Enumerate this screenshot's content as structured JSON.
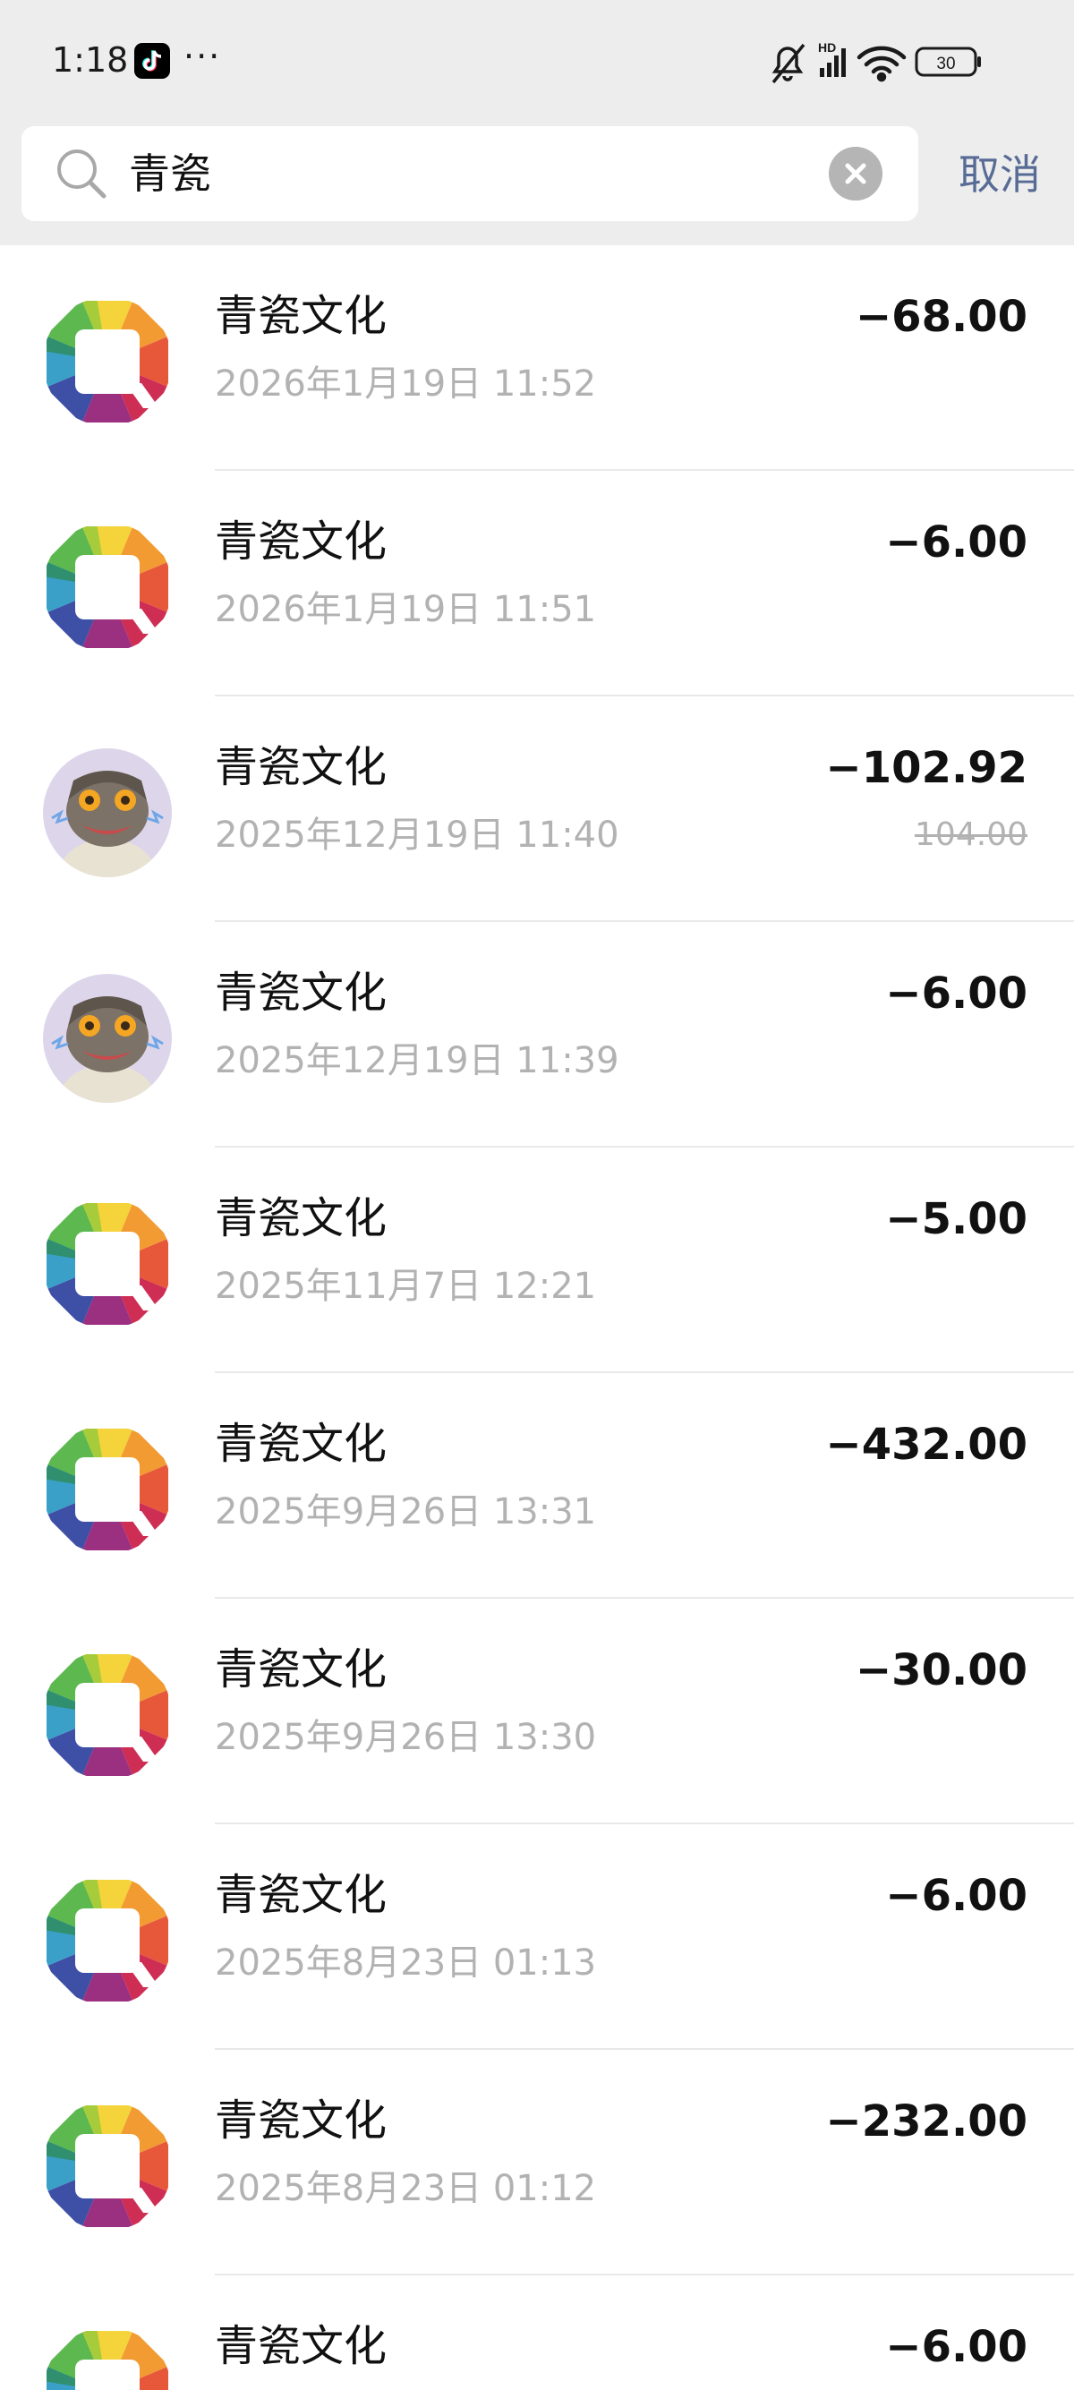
{
  "status_bar": {
    "time": "1:18",
    "overflow": "···",
    "icons": [
      "tiktok-icon",
      "mute-icon",
      "signal-icon",
      "wifi-icon",
      "battery-icon"
    ],
    "battery_level": "30"
  },
  "search": {
    "query": "青瓷",
    "cancel_label": "取消"
  },
  "colors": {
    "header_bg": "#ededed",
    "cancel": "#576b95",
    "secondary_text": "#b2b2b2"
  },
  "transactions": [
    {
      "merchant": "青瓷文化",
      "date": "2026年1月19日 11:52",
      "amount": "−68.00",
      "avatar": "logo-q"
    },
    {
      "merchant": "青瓷文化",
      "date": "2026年1月19日 11:51",
      "amount": "−6.00",
      "avatar": "logo-q"
    },
    {
      "merchant": "青瓷文化",
      "date": "2025年12月19日 11:40",
      "amount": "−102.92",
      "original_amount": "104.00",
      "avatar": "character"
    },
    {
      "merchant": "青瓷文化",
      "date": "2025年12月19日 11:39",
      "amount": "−6.00",
      "avatar": "character"
    },
    {
      "merchant": "青瓷文化",
      "date": "2025年11月7日 12:21",
      "amount": "−5.00",
      "avatar": "logo-q"
    },
    {
      "merchant": "青瓷文化",
      "date": "2025年9月26日 13:31",
      "amount": "−432.00",
      "avatar": "logo-q"
    },
    {
      "merchant": "青瓷文化",
      "date": "2025年9月26日 13:30",
      "amount": "−30.00",
      "avatar": "logo-q"
    },
    {
      "merchant": "青瓷文化",
      "date": "2025年8月23日 01:13",
      "amount": "−6.00",
      "avatar": "logo-q"
    },
    {
      "merchant": "青瓷文化",
      "date": "2025年8月23日 01:12",
      "amount": "−232.00",
      "avatar": "logo-q"
    },
    {
      "merchant": "青瓷文化",
      "amount": "−6.00",
      "avatar": "logo-q"
    }
  ]
}
